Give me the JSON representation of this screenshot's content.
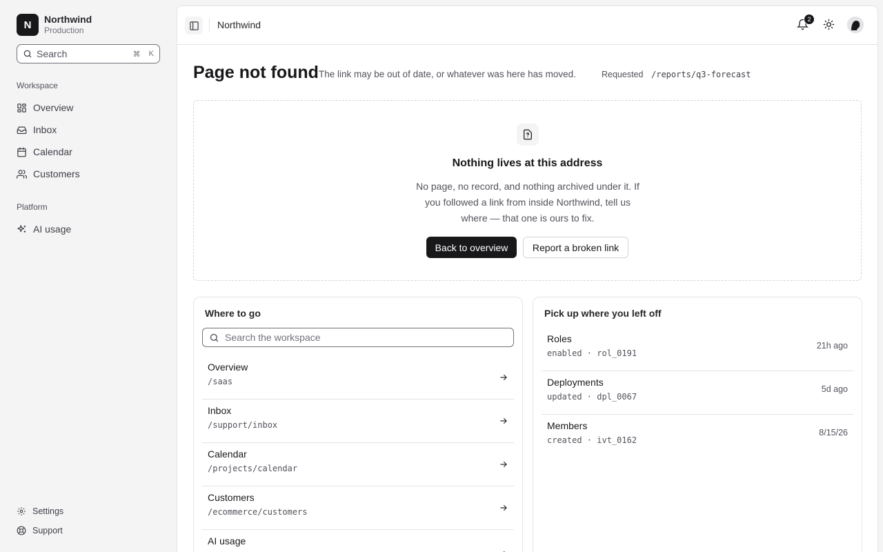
{
  "brand": {
    "logo_letter": "N",
    "name": "Northwind",
    "environment": "Production"
  },
  "sidebar": {
    "search_label": "Search",
    "search_shortcut": [
      "⌘",
      "K"
    ],
    "sections": [
      {
        "heading": "Workspace",
        "items": [
          {
            "label": "Overview",
            "icon": "layout-grid-icon"
          },
          {
            "label": "Inbox",
            "icon": "inbox-icon"
          },
          {
            "label": "Calendar",
            "icon": "calendar-icon"
          },
          {
            "label": "Customers",
            "icon": "users-icon"
          }
        ]
      },
      {
        "heading": "Platform",
        "items": [
          {
            "label": "AI usage",
            "icon": "sparkles-icon"
          }
        ]
      }
    ],
    "footer": [
      {
        "label": "Settings",
        "icon": "gear-icon"
      },
      {
        "label": "Support",
        "icon": "lifebuoy-icon"
      }
    ]
  },
  "header": {
    "breadcrumb": "Northwind",
    "notification_count": "2"
  },
  "page": {
    "title": "Page not found",
    "subtitle": "The link may be out of date, or whatever was here has moved.",
    "requested_label": "Requested",
    "requested_path": "/reports/q3-forecast"
  },
  "empty_state": {
    "icon": "file-question-icon",
    "title": "Nothing lives at this address",
    "body": "No page, no record, and nothing archived under it. If you followed a link from inside Northwind, tell us where — that one is ours to fix.",
    "primary_label": "Back to overview",
    "secondary_label": "Report a broken link"
  },
  "where_to_go": {
    "title": "Where to go",
    "search_placeholder": "Search the workspace",
    "destinations": [
      {
        "name": "Overview",
        "path": "/saas"
      },
      {
        "name": "Inbox",
        "path": "/support/inbox"
      },
      {
        "name": "Calendar",
        "path": "/projects/calendar"
      },
      {
        "name": "Customers",
        "path": "/ecommerce/customers"
      },
      {
        "name": "AI usage",
        "path": ""
      }
    ]
  },
  "recent": {
    "title": "Pick up where you left off",
    "items": [
      {
        "name": "Roles",
        "meta": "enabled · rol_0191",
        "time": "21h ago"
      },
      {
        "name": "Deployments",
        "meta": "updated · dpl_0067",
        "time": "5d ago"
      },
      {
        "name": "Members",
        "meta": "created · ivt_0162",
        "time": "8/15/26"
      }
    ]
  }
}
